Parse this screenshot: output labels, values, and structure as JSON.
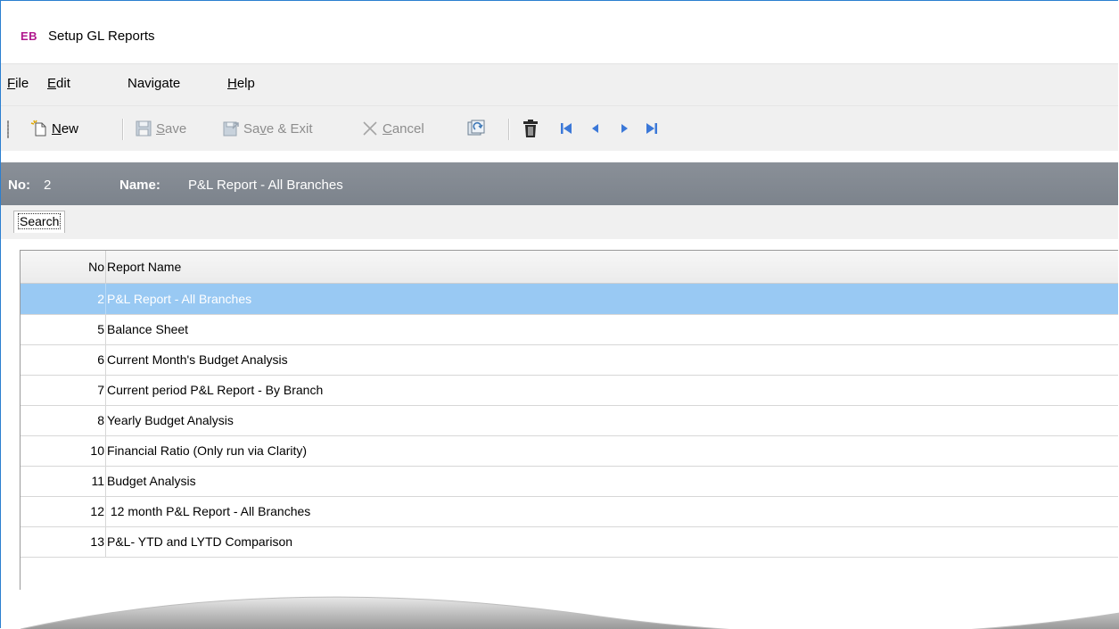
{
  "window": {
    "app_logo": "EB",
    "title": "Setup GL Reports"
  },
  "menu": [
    {
      "underline": "F",
      "rest": "ile"
    },
    {
      "underline": "E",
      "rest": "dit"
    },
    {
      "prefix": "Navigate",
      "underline": "",
      "rest": ""
    },
    {
      "underline": "H",
      "rest": "elp"
    }
  ],
  "toolbar": {
    "new_u": "N",
    "new_rest": "ew",
    "save_u": "S",
    "save_rest": "ave",
    "saveexit_pre": "Sa",
    "saveexit_u": "v",
    "saveexit_rest": "e & Exit",
    "cancel_u": "C",
    "cancel_rest": "ancel"
  },
  "record": {
    "no_label": "No:",
    "no_value": "2",
    "name_label": "Name:",
    "name_value": "P&L Report - All Branches"
  },
  "tabs": {
    "search": "Search"
  },
  "grid": {
    "columns": {
      "no": "No",
      "name": "Report Name"
    },
    "rows": [
      {
        "no": "2",
        "name": "P&L Report - All Branches",
        "selected": true
      },
      {
        "no": "5",
        "name": "Balance Sheet"
      },
      {
        "no": "6",
        "name": "Current Month's Budget Analysis"
      },
      {
        "no": "7",
        "name": "Current period P&L Report - By Branch"
      },
      {
        "no": "8",
        "name": "Yearly Budget Analysis"
      },
      {
        "no": "10",
        "name": "Financial Ratio (Only run via Clarity)"
      },
      {
        "no": "11",
        "name": "Budget Analysis"
      },
      {
        "no": "12",
        "name": " 12 month P&L Report - All Branches"
      },
      {
        "no": "13",
        "name": "P&L- YTD and LYTD Comparison"
      }
    ]
  },
  "colors": {
    "selection": "#99c9f3",
    "infobar": "#838a93",
    "logo": "#b0178d"
  },
  "icons": [
    "new-icon",
    "save-icon",
    "save-exit-icon",
    "cancel-icon",
    "refresh-icon",
    "delete-icon",
    "first-record-icon",
    "previous-record-icon",
    "next-record-icon",
    "last-record-icon"
  ]
}
